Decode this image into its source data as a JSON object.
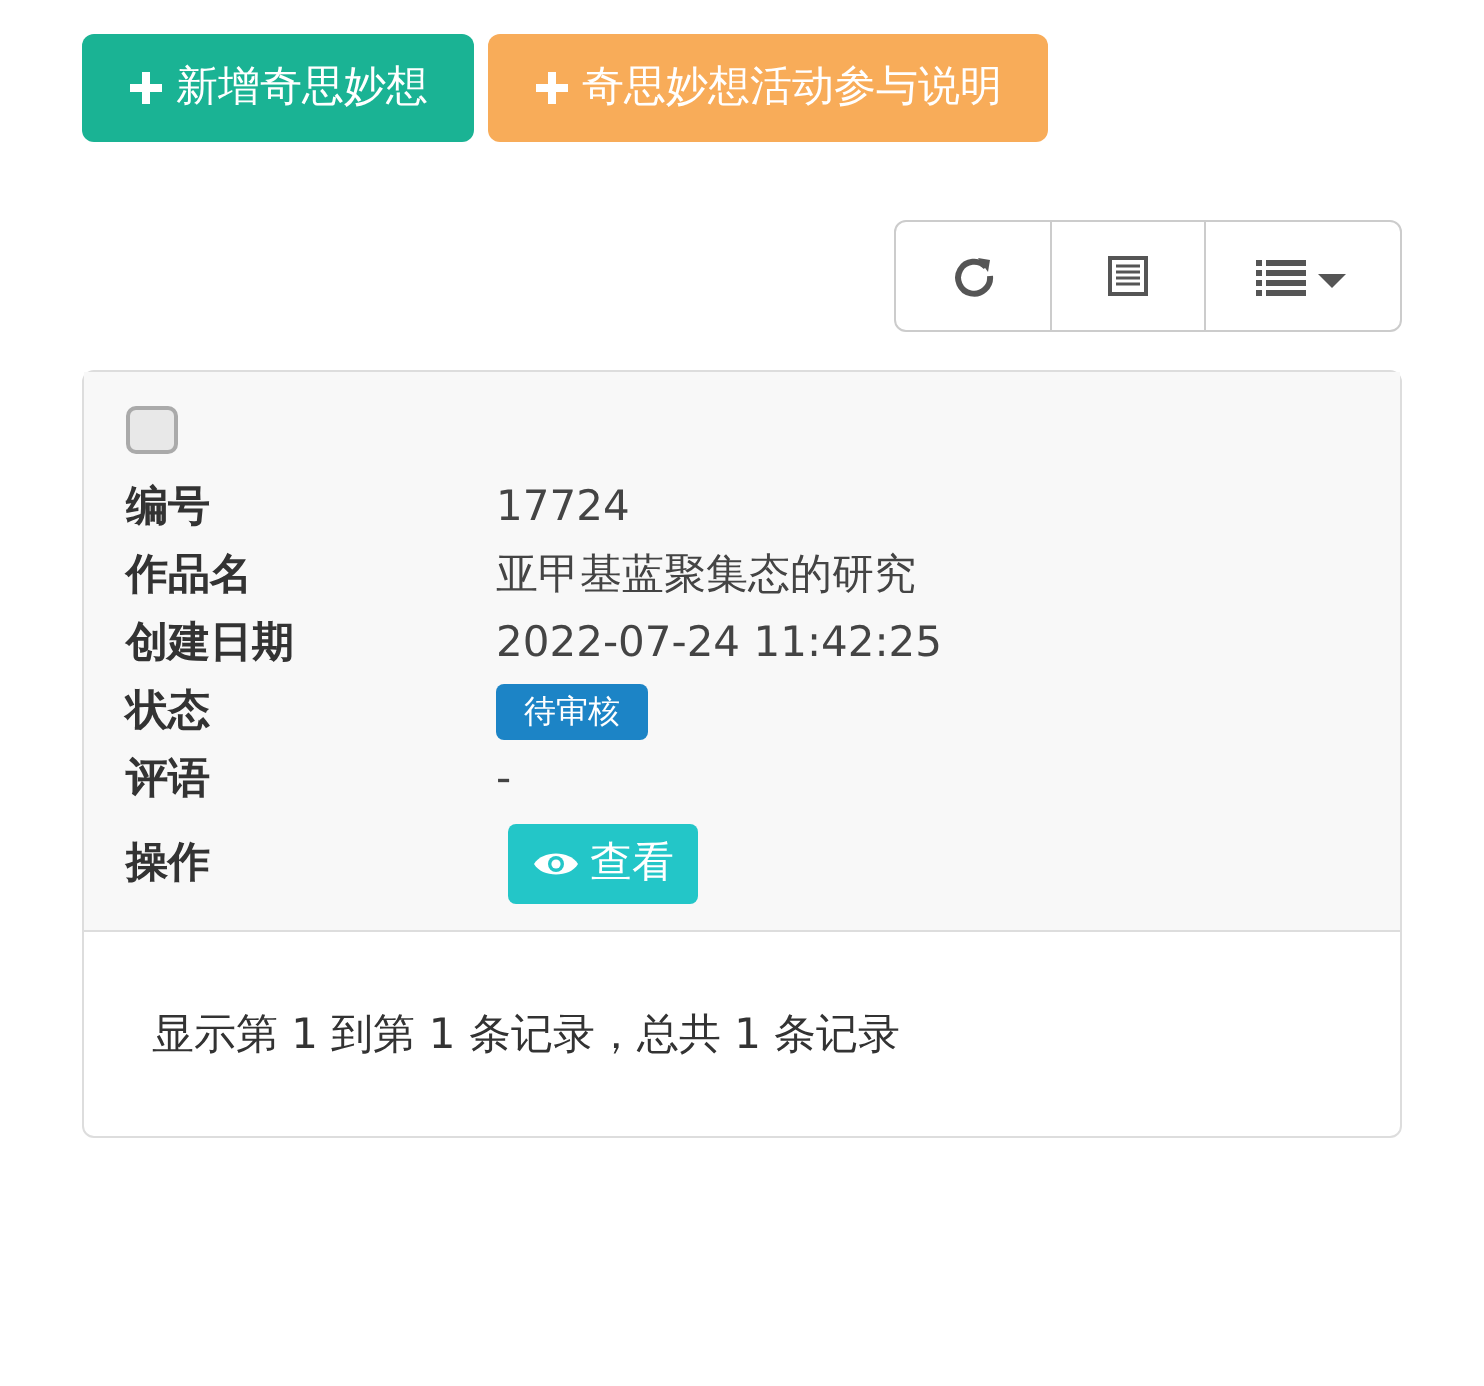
{
  "actions": [
    {
      "label": "新增奇思妙想",
      "kind": "primary"
    },
    {
      "label": "奇思妙想活动参与说明",
      "kind": "warning"
    }
  ],
  "toolbar": [
    {
      "kind": "refresh"
    },
    {
      "kind": "columns"
    },
    {
      "kind": "list"
    }
  ],
  "card": {
    "checked": false,
    "fields": [
      {
        "label": "编号",
        "kind": "text",
        "value": "17724"
      },
      {
        "label": "作品名",
        "kind": "text",
        "value": "亚甲基蓝聚集态的研究"
      },
      {
        "label": "创建日期",
        "kind": "text",
        "value": "2022-07-24 11:42:25"
      },
      {
        "label": "状态",
        "kind": "badge",
        "value": "待审核"
      },
      {
        "label": "评语",
        "kind": "text",
        "value": "-"
      },
      {
        "label": "操作",
        "kind": "button",
        "value": "查看"
      }
    ]
  },
  "footer": "显示第 1 到第 1 条记录，总共 1 条记录"
}
